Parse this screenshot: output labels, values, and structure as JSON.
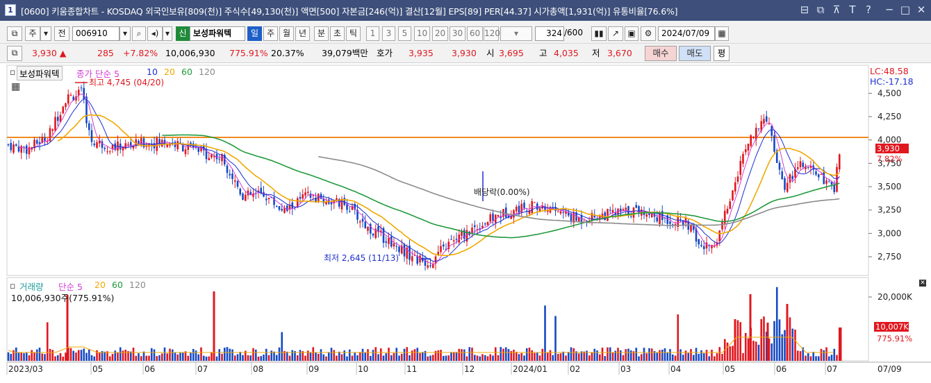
{
  "window": {
    "number": "1",
    "title": "[0600] 키움종합차트 - KOSDAQ 외국인보유[809(천)] 주식수[49,130(천)] 액면[500] 자본금[246(억)] 결산[12월] EPS[89] PER[44.37] 시가총액[1,931(억)] 유통비율[76.6%]",
    "controls": [
      "⊟",
      "⧉",
      "⊼",
      "T",
      "?",
      "─",
      "□",
      "✕"
    ]
  },
  "toolbar": {
    "layout_icon": "layout-icon",
    "market": "주",
    "prev": "전",
    "code": "006910",
    "sound_icon": "speaker-icon",
    "new_label": "신",
    "stock_name": "보성파워텍",
    "periods": [
      "일",
      "주",
      "월",
      "년",
      "분",
      "초",
      "틱"
    ],
    "selected_period": "일",
    "tick_options": [
      "1",
      "3",
      "5",
      "10",
      "20",
      "30",
      "60",
      "120"
    ],
    "count": "324",
    "total": "/600",
    "date": "2024/07/09"
  },
  "quote": {
    "price": "3,930 ▲",
    "change": "285",
    "change_pct": "+7.82%",
    "volume": "10,006,930",
    "volume_ratio": "775.91%",
    "turnover": "20.37%",
    "amount": "39,079백만",
    "ask_label": "호가",
    "ask1": "3,935",
    "bid1": "3,930",
    "open_label": "시",
    "open": "3,695",
    "high_label": "고",
    "high": "4,035",
    "low_label": "저",
    "low": "3,670",
    "buy": "매수",
    "sell": "매도",
    "eval": "평"
  },
  "price_pane": {
    "stock_tag": "보성파워텍",
    "ma_label": "종가 단순 5",
    "ma_periods": [
      "10",
      "20",
      "60",
      "120"
    ],
    "lc": "LC:48.58",
    "hc": "HC:-17.18",
    "high_note": "최고 4,745 (04/20)",
    "low_note": "최저 2,645 (11/13)",
    "dividend_note": "배당락(0.00%)",
    "last_price": "3,930",
    "last_pct": "7.82%",
    "y_ticks": [
      "4,500",
      "4,250",
      "4,000",
      "3,750",
      "3,500",
      "3,250",
      "3,000",
      "2,750"
    ]
  },
  "volume_pane": {
    "label": "거래량",
    "ma_label": "단순 5",
    "ma_periods": [
      "20",
      "60",
      "120"
    ],
    "current": "10,006,930주(775.91%)",
    "y_tick": "20,000K",
    "last_volume": "10,007K",
    "last_pct": "775.91%"
  },
  "x_axis": [
    "2023/03",
    "05",
    "06",
    "07",
    "08",
    "09",
    "10",
    "11",
    "12",
    "2024/01",
    "02",
    "03",
    "04",
    "05",
    "06",
    "07"
  ],
  "x_axis_end": "07/09",
  "colors": {
    "up": "#e0171f",
    "down": "#1549c4",
    "ma5": "#d43ad4",
    "ma10": "#1c2fcf",
    "ma20": "#f0a800",
    "ma60": "#1f9a3c",
    "ma120": "#8a8a8a",
    "hline": "#f08a20"
  },
  "chart_data": {
    "type": "line",
    "title": "",
    "ylim": [
      2550,
      4800
    ],
    "series": [
      {
        "name": "종가",
        "x": [
          "2023/03",
          "2023/04",
          "2023/05",
          "2023/06",
          "2023/07",
          "2023/08",
          "2023/09",
          "2023/10",
          "2023/11",
          "2023/12",
          "2024/01",
          "2024/02",
          "2024/03",
          "2024/04",
          "2024/05",
          "2024/06",
          "2024/07"
        ],
        "values": [
          3950,
          4300,
          3900,
          3980,
          3900,
          3450,
          3350,
          3050,
          2750,
          3150,
          3300,
          3150,
          3200,
          2850,
          4050,
          3650,
          3930
        ]
      }
    ]
  }
}
